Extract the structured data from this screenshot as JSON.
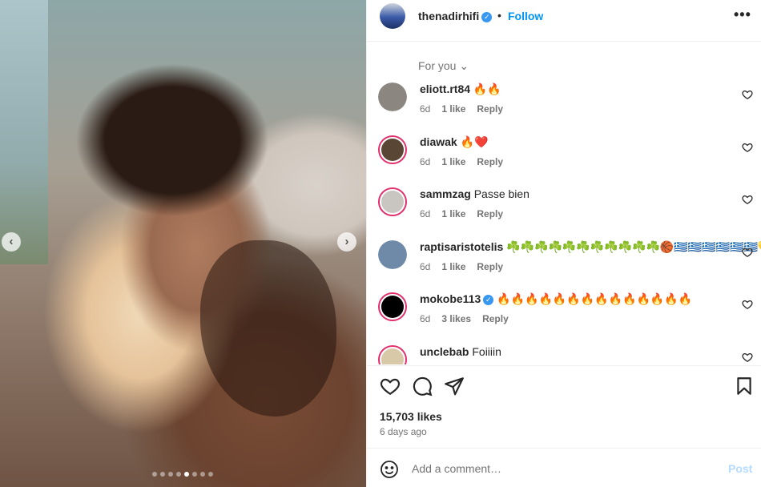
{
  "post": {
    "username": "thenadirhifi",
    "verified_mark": "✓",
    "separator": "•",
    "follow_label": "Follow",
    "more_icon": "more-horizontal-icon",
    "more_label": "•••"
  },
  "media": {
    "prev_arrow": "‹",
    "next_arrow": "›",
    "slide_count": 8,
    "active_slide": 5
  },
  "comments_section": {
    "sort_label": "For you",
    "sort_chevron": "⌄",
    "items": [
      {
        "username": "eliott.rt84",
        "verified": false,
        "text": "🔥🔥",
        "age": "6d",
        "likes": "1 like",
        "reply": "Reply",
        "avatar_color": "#8b8780",
        "ring": false
      },
      {
        "username": "diawak",
        "verified": false,
        "text": "🔥❤️",
        "age": "6d",
        "likes": "1 like",
        "reply": "Reply",
        "avatar_color": "#5a4634",
        "ring": true
      },
      {
        "username": "sammzag",
        "verified": false,
        "text": "Passe bien",
        "age": "6d",
        "likes": "1 like",
        "reply": "Reply",
        "avatar_color": "#c9c6c1",
        "ring": true
      },
      {
        "username": "raptisaristotelis",
        "verified": false,
        "text": "☘️☘️☘️☘️☘️☘️☘️☘️☘️☘️☘️🏀🇬🇷🇬🇷🇬🇷🇬🇷🇬🇷🇬🇷💛⭐",
        "age": "6d",
        "likes": "1 like",
        "reply": "Reply",
        "avatar_color": "#6f8aa8",
        "ring": false
      },
      {
        "username": "mokobe113",
        "verified": true,
        "text": "🔥🔥🔥🔥🔥🔥🔥🔥🔥🔥🔥🔥🔥🔥",
        "age": "6d",
        "likes": "3 likes",
        "reply": "Reply",
        "avatar_color": "#000000",
        "ring": true
      },
      {
        "username": "unclebab",
        "verified": false,
        "text": "Foiiiin",
        "age": "",
        "likes": "",
        "reply": "",
        "avatar_color": "#d8c9a8",
        "ring": true
      }
    ]
  },
  "actions": {
    "like_icon": "heart-icon",
    "comment_icon": "comment-icon",
    "share_icon": "send-icon",
    "save_icon": "bookmark-icon",
    "likes_count": "15,703 likes",
    "posted_time": "6 days ago"
  },
  "composer": {
    "emoji_icon": "smiley-icon",
    "placeholder": "Add a comment…",
    "post_label": "Post"
  },
  "colors": {
    "accent_blue": "#0095f6",
    "post_disabled": "#b3dbff",
    "story_ring": "#e1306c",
    "muted_text": "#737373"
  }
}
